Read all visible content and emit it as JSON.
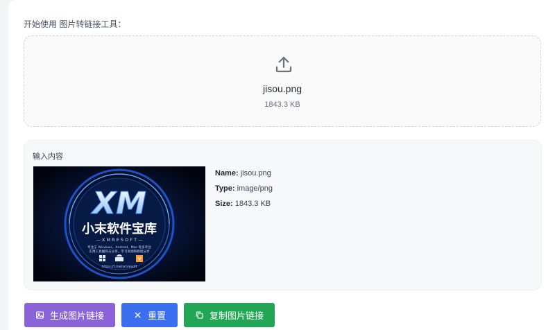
{
  "intro": {
    "text": "开始使用 图片转链接工具："
  },
  "upload": {
    "icon": "upload-icon",
    "file_name": "jisou.png",
    "file_size": "1843.3 KB"
  },
  "input_panel": {
    "title": "输入内容",
    "preview": {
      "logo_text": "XM",
      "title": "小末软件宝库",
      "subtitle": "— X M  R E S O F T —",
      "desc_line1": "专注于 Windows、Android、Mac 等多平台",
      "desc_line2": "实用工具推荐与分享，学习资源和教程分享",
      "url": "https://t.me/xmresoft"
    },
    "meta": {
      "name_label": "Name:",
      "name_value": "jisou.png",
      "type_label": "Type:",
      "type_value": "image/png",
      "size_label": "Size:",
      "size_value": "1843.3 KB"
    }
  },
  "buttons": {
    "generate": {
      "label": "生成图片链接",
      "icon": "image-icon",
      "color": "#8b63d9"
    },
    "reset": {
      "label": "重置",
      "icon": "close-icon",
      "color": "#3b6ff0"
    },
    "copy": {
      "label": "复制图片链接",
      "icon": "copy-icon",
      "color": "#22a554"
    }
  }
}
